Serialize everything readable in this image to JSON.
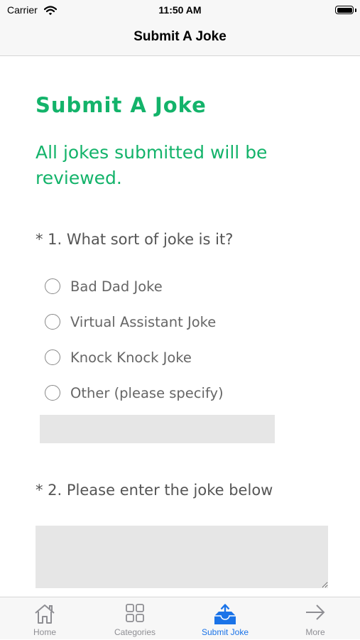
{
  "status_bar": {
    "carrier": "Carrier",
    "time": "11:50 AM"
  },
  "nav": {
    "title": "Submit A Joke"
  },
  "form": {
    "heading": "Submit A Joke",
    "subtitle": "All jokes submitted will be reviewed.",
    "question1": {
      "label": "* 1. What sort of joke is it?",
      "options": [
        "Bad Dad Joke",
        "Virtual Assistant Joke",
        "Knock Knock Joke",
        "Other (please specify)"
      ],
      "other_value": ""
    },
    "question2": {
      "label": "* 2. Please enter the joke below",
      "value": ""
    }
  },
  "tabs": [
    {
      "label": "Home",
      "icon": "home-icon",
      "active": false
    },
    {
      "label": "Categories",
      "icon": "grid-icon",
      "active": false
    },
    {
      "label": "Submit Joke",
      "icon": "upload-tray-icon",
      "active": true
    },
    {
      "label": "More",
      "icon": "arrow-right-icon",
      "active": false
    }
  ],
  "colors": {
    "accent": "#13b36a",
    "tab_active": "#1a73e8",
    "tab_inactive": "#8e8e93"
  }
}
